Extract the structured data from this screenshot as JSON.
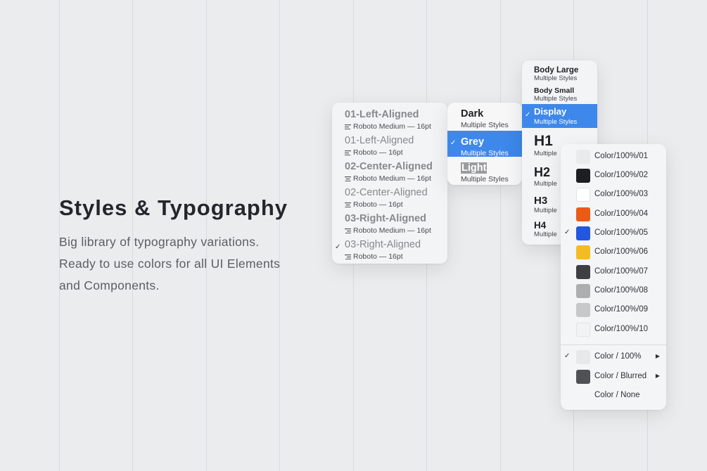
{
  "hero": {
    "title": "Styles & Typography",
    "lines": [
      "Big library of typography variations.",
      "Ready to use colors for all UI Elements",
      "and Components."
    ]
  },
  "align_menu": {
    "items": [
      {
        "name": "01-Left-Aligned",
        "sub": "Roboto Medium — 16pt",
        "bold": true,
        "selected": false,
        "icon": "align-left-icon"
      },
      {
        "name": "01-Left-Aligned",
        "sub": "Roboto — 16pt",
        "bold": false,
        "selected": false,
        "icon": "align-left-icon"
      },
      {
        "name": "02-Center-Aligned",
        "sub": "Roboto Medium — 16pt",
        "bold": true,
        "selected": false,
        "icon": "align-center-icon"
      },
      {
        "name": "02-Center-Aligned",
        "sub": "Roboto — 16pt",
        "bold": false,
        "selected": false,
        "icon": "align-center-icon"
      },
      {
        "name": "03-Right-Aligned",
        "sub": "Roboto Medium — 16pt",
        "bold": true,
        "selected": false,
        "icon": "align-right-icon"
      },
      {
        "name": "03-Right-Aligned",
        "sub": "Roboto — 16pt",
        "bold": false,
        "selected": true,
        "icon": "align-right-icon"
      }
    ]
  },
  "theme_menu": {
    "items": [
      {
        "name": "Dark",
        "sub": "Multiple Styles",
        "selected": false
      },
      {
        "name": "Grey",
        "sub": "Multiple Styles",
        "selected": true
      },
      {
        "name": "Light",
        "sub": "Multiple Styles",
        "selected": false
      }
    ]
  },
  "type_menu": {
    "items": [
      {
        "name": "Body Large",
        "sub": "Multiple Styles"
      },
      {
        "name": "Body Small",
        "sub": "Multiple Styles"
      },
      {
        "name": "Display",
        "sub": "Multiple Styles",
        "selected": true
      },
      {
        "name": "H1",
        "sub": "Multiple"
      },
      {
        "name": "H2",
        "sub": "Multiple"
      },
      {
        "name": "H3",
        "sub": "Multiple"
      },
      {
        "name": "H4",
        "sub": "Multiple"
      }
    ]
  },
  "color_menu": {
    "items": [
      {
        "label": "Color/100%/01",
        "color": "#e9eaec",
        "selected": false
      },
      {
        "label": "Color/100%/02",
        "color": "#1d1e24",
        "selected": false
      },
      {
        "label": "Color/100%/03",
        "color": "#ffffff",
        "selected": false
      },
      {
        "label": "Color/100%/04",
        "color": "#ec5a16",
        "selected": false
      },
      {
        "label": "Color/100%/05",
        "color": "#2457e0",
        "selected": true
      },
      {
        "label": "Color/100%/06",
        "color": "#f4bc23",
        "selected": false
      },
      {
        "label": "Color/100%/07",
        "color": "#3e3f43",
        "selected": false
      },
      {
        "label": "Color/100%/08",
        "color": "#adaeb0",
        "selected": false
      },
      {
        "label": "Color/100%/09",
        "color": "#c7c8ca",
        "selected": false
      },
      {
        "label": "Color/100%/10",
        "color": "#f2f3f4",
        "selected": false
      }
    ],
    "groups": [
      {
        "label": "Color / 100%",
        "color": "#e7e8ea",
        "selected": true,
        "submenu": true
      },
      {
        "label": "Color / Blurred",
        "color": "#505154",
        "selected": false,
        "submenu": true
      },
      {
        "label": "Color / None",
        "color": "",
        "selected": false,
        "submenu": false
      }
    ]
  },
  "accent": "#3d88ea"
}
